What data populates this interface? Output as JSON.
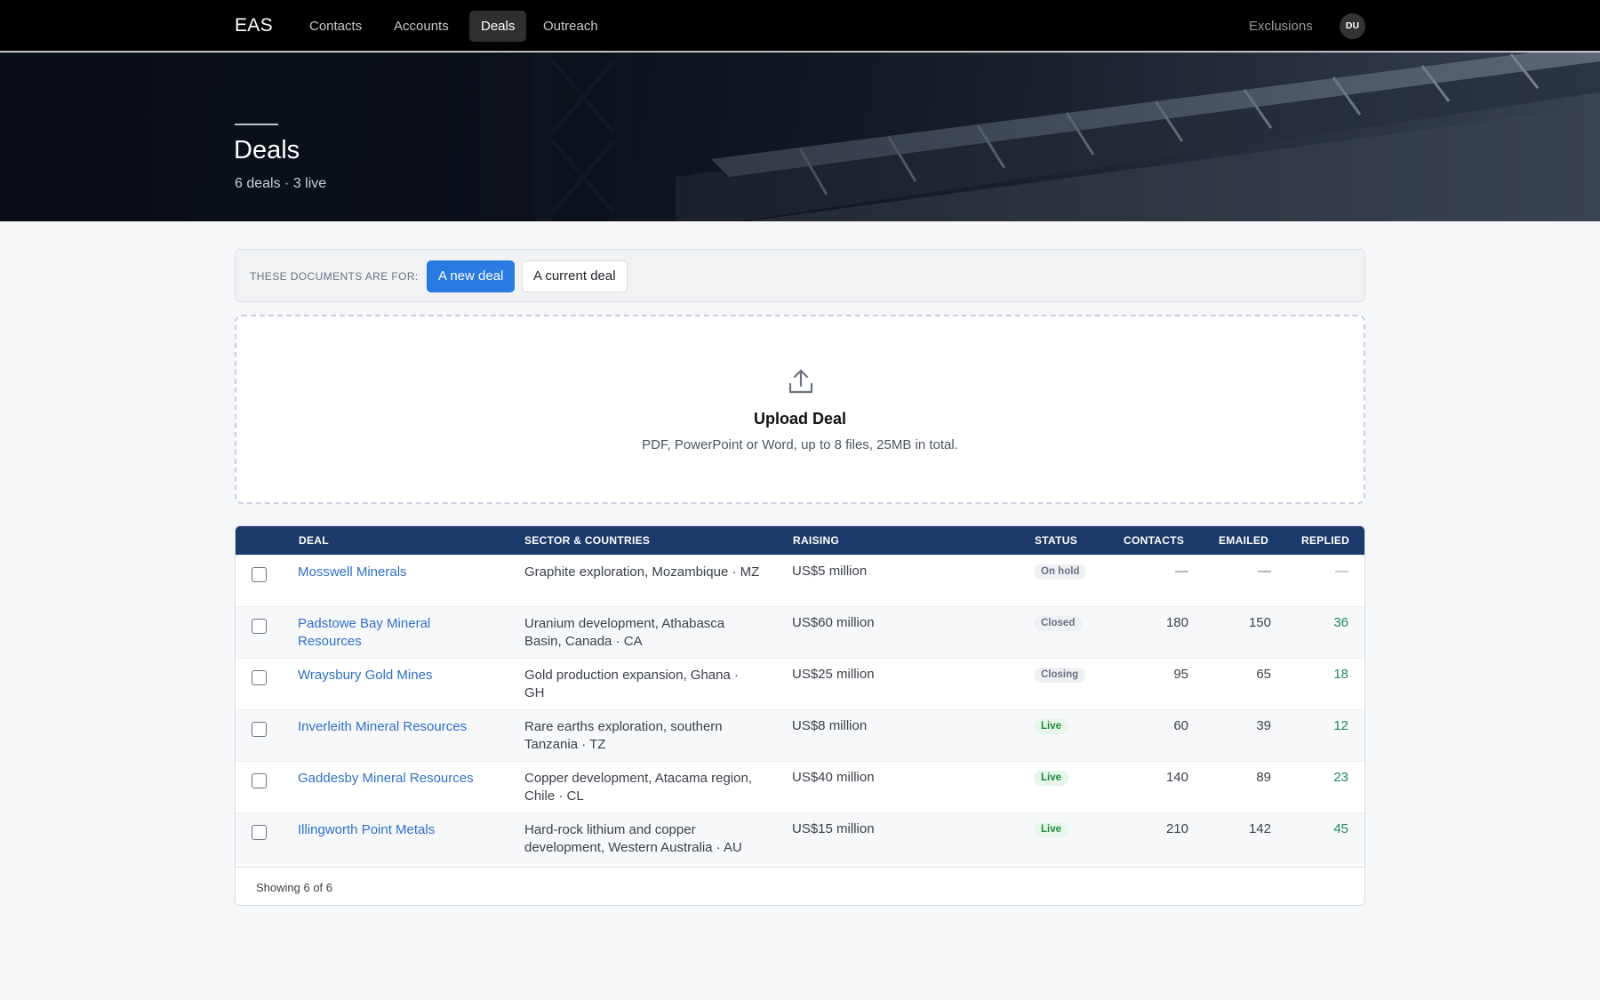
{
  "nav": {
    "brand": "EAS",
    "items": [
      "Contacts",
      "Accounts",
      "Deals",
      "Outreach"
    ],
    "active": "Deals",
    "exclusions": "Exclusions",
    "avatar": "DU"
  },
  "hero": {
    "title": "Deals",
    "subtitle": "6 deals · 3 live"
  },
  "documents": {
    "label": "THESE DOCUMENTS ARE FOR:",
    "option_new": "A new deal",
    "option_current": "A current deal",
    "selected": "A new deal"
  },
  "upload": {
    "icon": "upload-icon",
    "title": "Upload Deal",
    "subtitle": "PDF, PowerPoint or Word, up to 8 files, 25MB in total."
  },
  "table": {
    "headers": [
      "DEAL",
      "SECTOR & COUNTRIES",
      "RAISING",
      "STATUS",
      "CONTACTS",
      "EMAILED",
      "REPLIED"
    ],
    "rows": [
      {
        "deal": "Mosswell Minerals",
        "sector": "Graphite exploration, Mozambique · MZ",
        "raising": "US$5 million",
        "status": "On hold",
        "contacts": "—",
        "emailed": "—",
        "replied": "—"
      },
      {
        "deal": "Padstowe Bay Mineral Resources",
        "sector": "Uranium development, Athabasca Basin, Canada · CA",
        "raising": "US$60 million",
        "status": "Closed",
        "contacts": "180",
        "emailed": "150",
        "replied": "36"
      },
      {
        "deal": "Wraysbury Gold Mines",
        "sector": "Gold production expansion, Ghana · GH",
        "raising": "US$25 million",
        "status": "Closing",
        "contacts": "95",
        "emailed": "65",
        "replied": "18"
      },
      {
        "deal": "Inverleith Mineral Resources",
        "sector": "Rare earths exploration, southern Tanzania · TZ",
        "raising": "US$8 million",
        "status": "Live",
        "contacts": "60",
        "emailed": "39",
        "replied": "12"
      },
      {
        "deal": "Gaddesby Mineral Resources",
        "sector": "Copper development, Atacama region, Chile · CL",
        "raising": "US$40 million",
        "status": "Live",
        "contacts": "140",
        "emailed": "89",
        "replied": "23"
      },
      {
        "deal": "Illingworth Point Metals",
        "sector": "Hard-rock lithium and copper development, Western Australia · AU",
        "raising": "US$15 million",
        "status": "Live",
        "contacts": "210",
        "emailed": "142",
        "replied": "45"
      }
    ],
    "footer": "Showing 6 of 6"
  },
  "colors": {
    "accent": "#2a7ae4",
    "header": "#1b3a6b",
    "link": "#2f6fc9",
    "live": "#1f8a3b",
    "replied": "#1e8a5a"
  }
}
